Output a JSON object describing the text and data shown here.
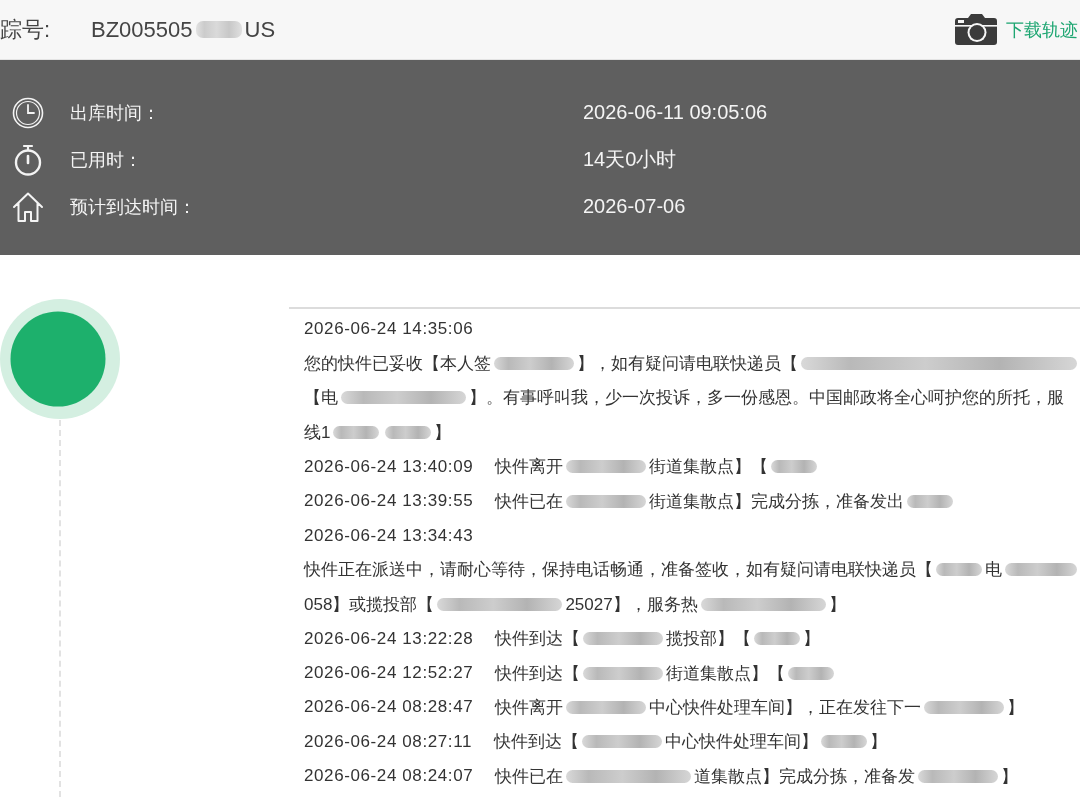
{
  "header": {
    "label": "踪号:",
    "tracking_number": [
      {
        "kind": "text",
        "text": "BZ005505"
      },
      {
        "kind": "blurshort"
      },
      {
        "kind": "text",
        "text": "US"
      }
    ],
    "download_link": "下载轨迹"
  },
  "summary": [
    {
      "kind": "clock",
      "label": "出库时间：",
      "value": "2026-06-11 09:05:06"
    },
    {
      "kind": "stopwatch",
      "label": "已用时：",
      "value": "14天0小时"
    },
    {
      "kind": "home",
      "label": "预计到达时间：",
      "value": "2026-07-06"
    }
  ],
  "events": [
    {
      "time": "2026-06-24 14:35:06",
      "kind": "stacked",
      "lines": [
        [
          {
            "kind": "text",
            "text": "您的快件已妥收【本人签"
          },
          {
            "kind": "blurmedium"
          },
          {
            "kind": "text",
            "text": "】，如有疑问请电联快递员【"
          },
          {
            "kind": "blurfill"
          }
        ],
        [
          {
            "kind": "text",
            "text": "【电"
          },
          {
            "kind": "blurlong"
          },
          {
            "kind": "text",
            "text": "】。有事呼叫我，少一次投诉，多一份感恩。中国邮政将全心呵护您的所托，服"
          }
        ],
        [
          {
            "kind": "text",
            "text": "线1"
          },
          {
            "kind": "blurshort"
          },
          {
            "kind": "blurshort"
          },
          {
            "kind": "text",
            "text": "】"
          }
        ]
      ]
    },
    {
      "time": "2026-06-24 13:40:09",
      "kind": "inline",
      "lines": [
        [
          {
            "kind": "text",
            "text": "快件离开"
          },
          {
            "kind": "blurmedium"
          },
          {
            "kind": "text",
            "text": "街道集散点】【"
          },
          {
            "kind": "blurshort"
          }
        ]
      ]
    },
    {
      "time": "2026-06-24 13:39:55",
      "kind": "inline",
      "lines": [
        [
          {
            "kind": "text",
            "text": "快件已在"
          },
          {
            "kind": "blurmedium"
          },
          {
            "kind": "text",
            "text": "街道集散点】完成分拣，准备发出"
          },
          {
            "kind": "blurshort"
          }
        ]
      ]
    },
    {
      "time": "2026-06-24 13:34:43",
      "kind": "stacked",
      "lines": [
        [
          {
            "kind": "text",
            "text": "快件正在派送中，请耐心等待，保持电话畅通，准备签收，如有疑问请电联快递员【"
          },
          {
            "kind": "blurshort"
          },
          {
            "kind": "text",
            "text": "电"
          },
          {
            "kind": "blurfill"
          }
        ],
        [
          {
            "kind": "text",
            "text": "058】或揽投部【"
          },
          {
            "kind": "blurlong"
          },
          {
            "kind": "text",
            "text": "25027】，服务热"
          },
          {
            "kind": "blurlong"
          },
          {
            "kind": "text",
            "text": "】"
          }
        ]
      ]
    },
    {
      "time": "2026-06-24 13:22:28",
      "kind": "inline",
      "lines": [
        [
          {
            "kind": "text",
            "text": "快件到达【"
          },
          {
            "kind": "blurmedium"
          },
          {
            "kind": "text",
            "text": "揽投部】【"
          },
          {
            "kind": "blurshort"
          },
          {
            "kind": "text",
            "text": "】"
          }
        ]
      ]
    },
    {
      "time": "2026-06-24 12:52:27",
      "kind": "inline",
      "lines": [
        [
          {
            "kind": "text",
            "text": "快件到达【"
          },
          {
            "kind": "blurmedium"
          },
          {
            "kind": "text",
            "text": "街道集散点】【"
          },
          {
            "kind": "blurshort"
          }
        ]
      ]
    },
    {
      "time": "2026-06-24 08:28:47",
      "kind": "inline",
      "lines": [
        [
          {
            "kind": "text",
            "text": "快件离开"
          },
          {
            "kind": "blurmedium"
          },
          {
            "kind": "text",
            "text": "中心快件处理车间】，正在发往下一"
          },
          {
            "kind": "blurmedium"
          },
          {
            "kind": "text",
            "text": "】"
          }
        ]
      ]
    },
    {
      "time": "2026-06-24 08:27:11",
      "kind": "inline",
      "lines": [
        [
          {
            "kind": "text",
            "text": "快件到达【"
          },
          {
            "kind": "blurmedium"
          },
          {
            "kind": "text",
            "text": "中心快件处理车间】"
          },
          {
            "kind": "blurshort"
          },
          {
            "kind": "text",
            "text": "】"
          }
        ]
      ]
    },
    {
      "time": "2026-06-24 08:24:07",
      "kind": "inline",
      "lines": [
        [
          {
            "kind": "text",
            "text": "快件已在"
          },
          {
            "kind": "blurlong"
          },
          {
            "kind": "text",
            "text": "道集散点】完成分拣，准备发"
          },
          {
            "kind": "blurmedium"
          },
          {
            "kind": "text",
            "text": "】"
          }
        ]
      ]
    }
  ]
}
